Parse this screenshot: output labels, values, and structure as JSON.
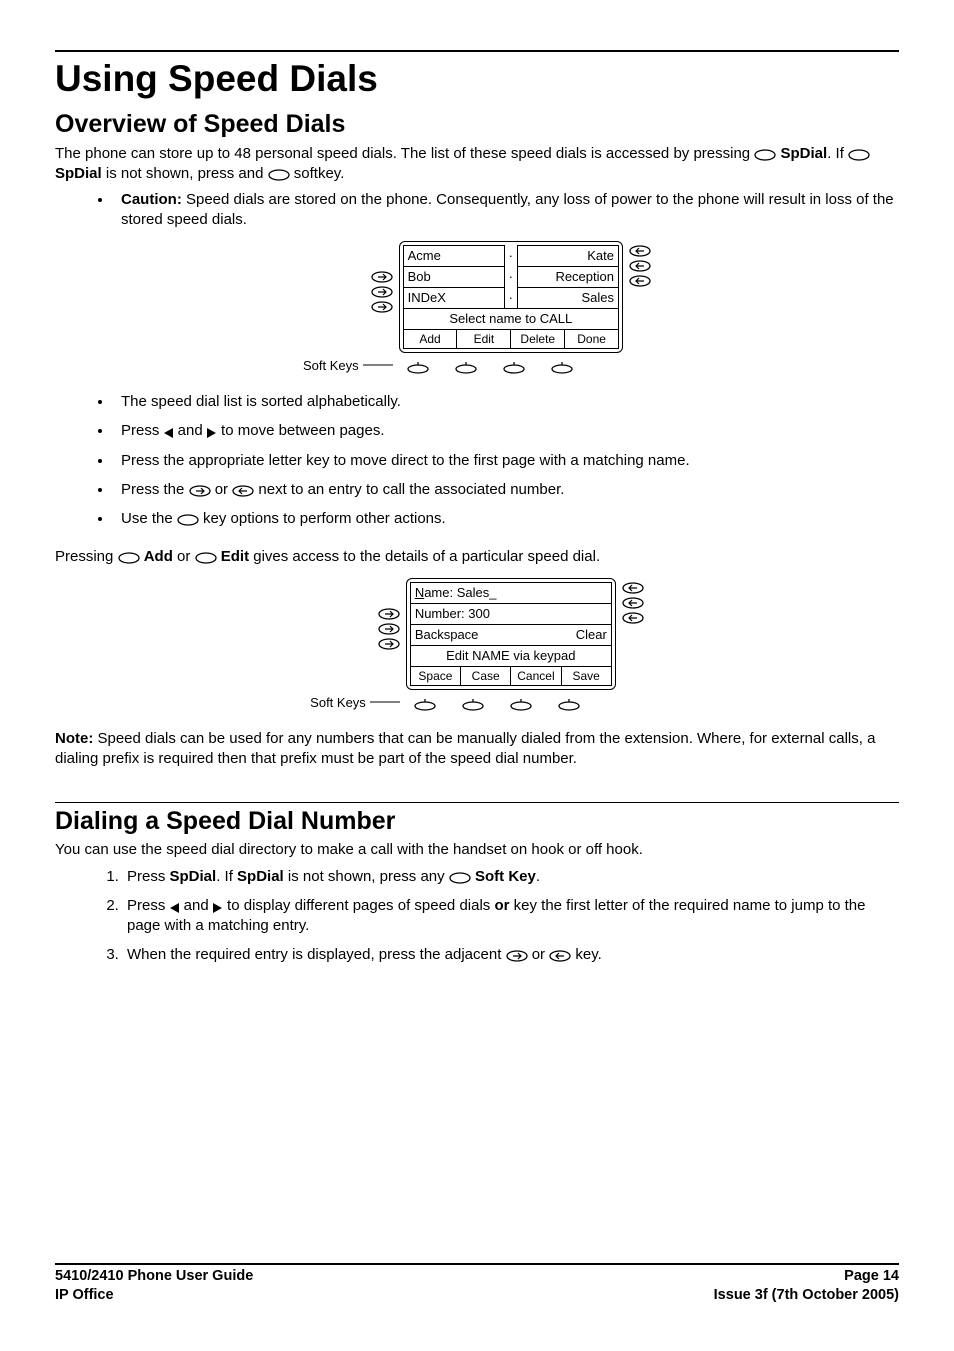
{
  "title": "Using Speed Dials",
  "section1": {
    "heading": "Overview of Speed Dials",
    "intro_a": "The phone can store up to 48 personal speed dials. The list of these speed dials is accessed by pressing ",
    "intro_b": "SpDial",
    "intro_c": ". If ",
    "intro_d": "SpDial",
    "intro_e": " is not shown, press and ",
    "intro_f": " softkey.",
    "caution_label": "Caution:",
    "caution_text": "  Speed dials are stored on the phone. Consequently, any loss of power to the phone will result in loss of the stored speed dials.",
    "bullets": [
      "The speed dial list is sorted alphabetically.",
      "Press __ARROWL__ and __ARROWR__ to move between pages.",
      "Press the appropriate letter key to move direct to the first page with a matching name.",
      "Press the __PILLR__ or __PILLL__ next to an entry to call the associated number.",
      "Use the __PILLO__ key options to perform other actions."
    ],
    "mid_a": "Pressing ",
    "mid_add": "Add",
    "mid_or": " or ",
    "mid_edit": "Edit",
    "mid_b": " gives access to the details of a particular speed dial.",
    "note_label": "Note:",
    "note_text": "  Speed dials can be used for any numbers that can be manually dialed from the extension. Where, for external calls, a dialing prefix is required then that prefix must be part of the speed dial number."
  },
  "diagram1": {
    "rows": [
      [
        "Acme",
        "Kate"
      ],
      [
        "Bob",
        "Reception"
      ],
      [
        "INDeX",
        "Sales"
      ]
    ],
    "prompt": "Select name to CALL",
    "softkeys": [
      "Add",
      "Edit",
      "Delete",
      "Done"
    ],
    "label": "Soft Keys"
  },
  "diagram2": {
    "rows": [
      "Name: Sales_",
      "Number: 300",
      "Backspace|Clear"
    ],
    "prompt": "Edit NAME via keypad",
    "softkeys": [
      "Space",
      "Case",
      "Cancel",
      "Save"
    ],
    "label": "Soft Keys"
  },
  "section2": {
    "heading": "Dialing a Speed Dial Number",
    "intro": "You can use the speed dial directory to make a call with the handset on hook or off hook.",
    "steps": [
      {
        "pre": "Press ",
        "b1": "SpDial",
        "mid": ". If ",
        "b2": "SpDial",
        "mid2": " is not shown, press any ",
        "b3": "Soft Key",
        "post": "."
      },
      {
        "pre": "Press __ARROWL__ and __ARROWR__ to display different pages of speed dials ",
        "b1": "or",
        "post": " key the first letter of the required name to jump to the page with a matching entry."
      },
      {
        "pre": "When the required entry is displayed, press the adjacent __PILLR__ or __PILLL__ key."
      }
    ]
  },
  "footer": {
    "left1": "5410/2410 Phone User Guide",
    "right1": "Page 14",
    "left2": "IP Office",
    "right2": "Issue 3f (7th October 2005)"
  }
}
